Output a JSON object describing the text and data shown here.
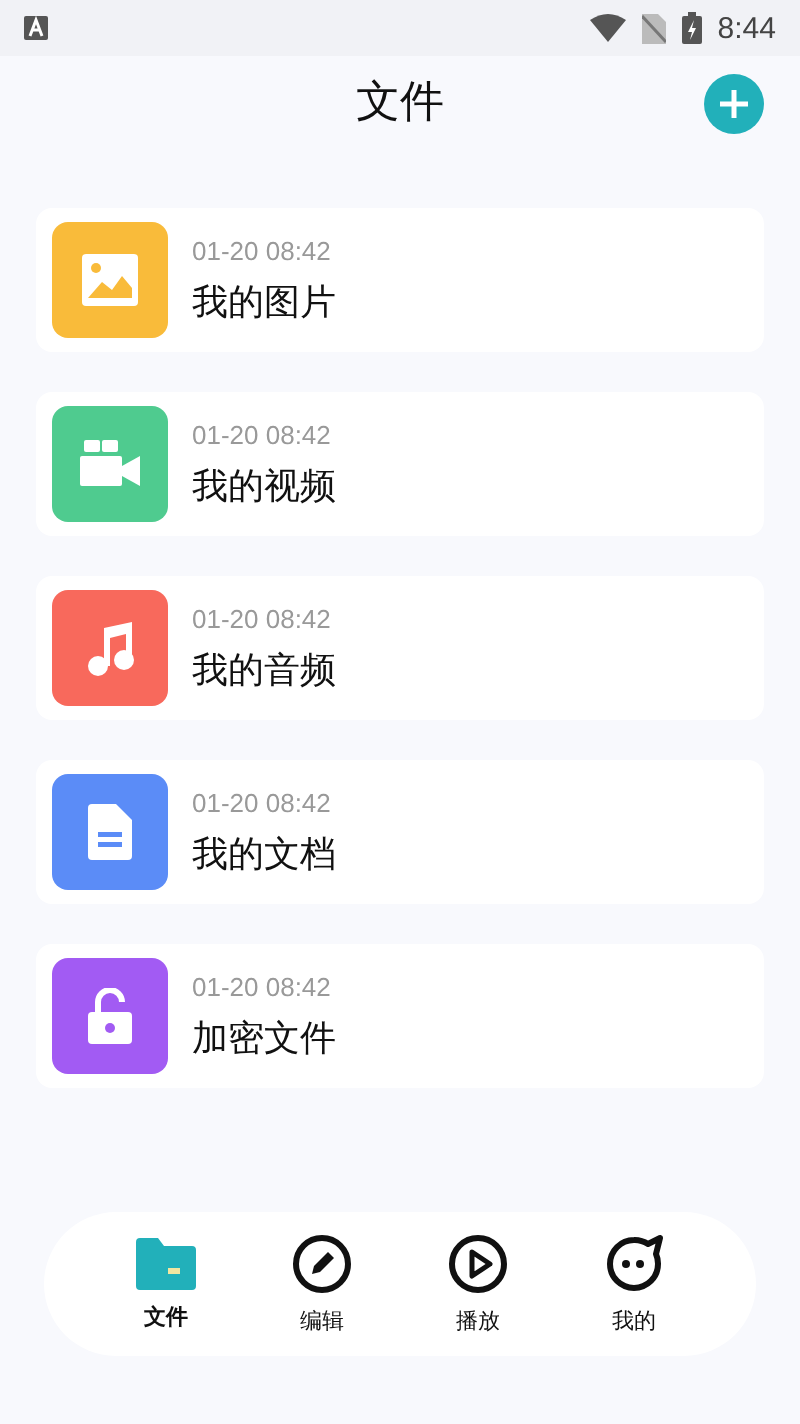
{
  "status_bar": {
    "time": "8:44"
  },
  "header": {
    "title": "文件"
  },
  "folders": [
    {
      "kind": "image",
      "color": "#f9bb3a",
      "time": "01-20 08:42",
      "name": "我的图片"
    },
    {
      "kind": "video",
      "color": "#4fcb8f",
      "time": "01-20 08:42",
      "name": "我的视频"
    },
    {
      "kind": "audio",
      "color": "#f8695c",
      "time": "01-20 08:42",
      "name": "我的音频"
    },
    {
      "kind": "document",
      "color": "#5b8cf7",
      "time": "01-20 08:42",
      "name": "我的文档"
    },
    {
      "kind": "lock",
      "color": "#a25bf3",
      "time": "01-20 08:42",
      "name": "加密文件"
    }
  ],
  "nav": [
    {
      "kind": "files",
      "label": "文件",
      "selected": true
    },
    {
      "kind": "edit",
      "label": "编辑",
      "selected": false
    },
    {
      "kind": "play",
      "label": "播放",
      "selected": false
    },
    {
      "kind": "me",
      "label": "我的",
      "selected": false
    }
  ]
}
